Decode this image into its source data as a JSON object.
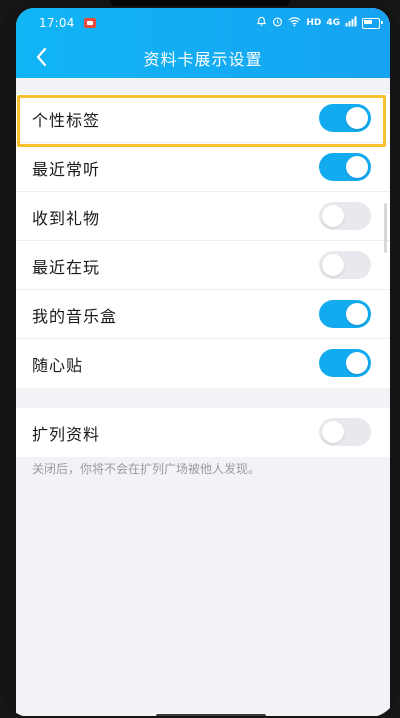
{
  "status_bar": {
    "time": "17:04",
    "network": "HD",
    "signal": "4G"
  },
  "header": {
    "title": "资料卡展示设置",
    "background_color": "#10b5f4"
  },
  "settings": [
    {
      "label": "个性标签",
      "enabled": true
    },
    {
      "label": "最近常听",
      "enabled": true
    },
    {
      "label": "收到礼物",
      "enabled": false
    },
    {
      "label": "最近在玩",
      "enabled": false
    },
    {
      "label": "我的音乐盒",
      "enabled": true
    },
    {
      "label": "随心贴",
      "enabled": true
    }
  ],
  "extended": {
    "label": "扩列资料",
    "enabled": false,
    "note": "关闭后，你将不会在扩列广场被他人发现。"
  },
  "colors": {
    "toggle_on": "#12abf0",
    "toggle_off": "#e8e8ee",
    "highlight": "#f7c02c"
  }
}
